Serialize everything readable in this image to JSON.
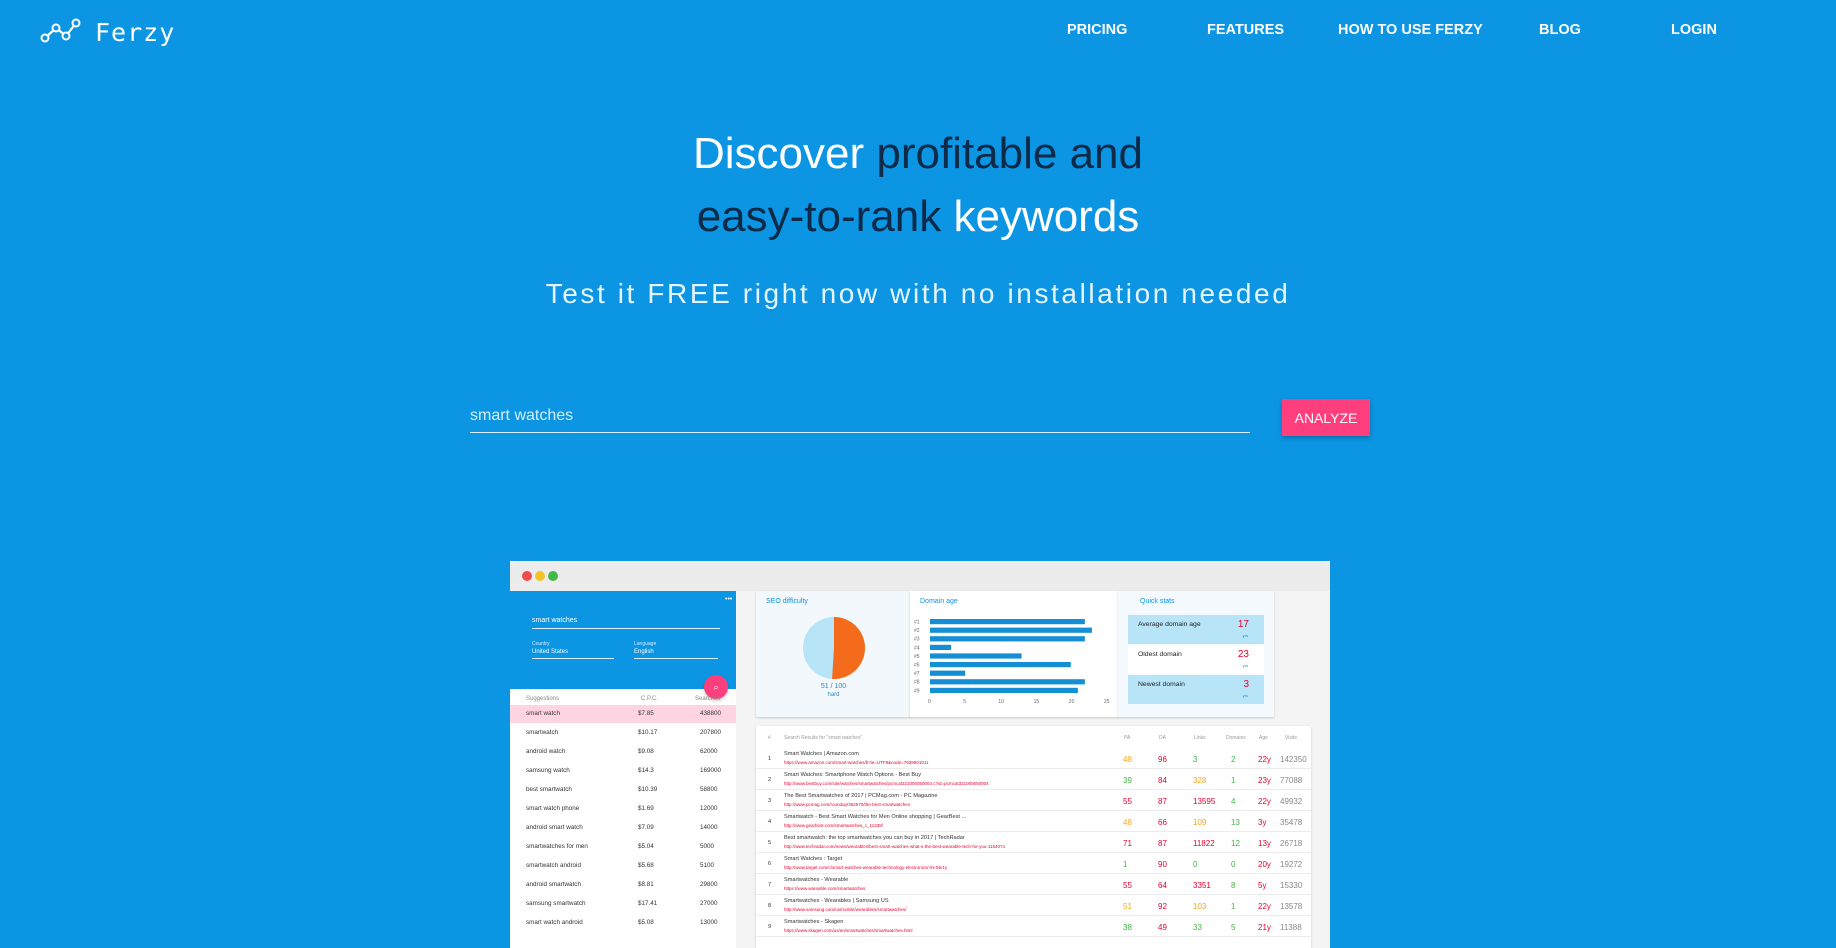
{
  "nav": {
    "brand": "Ferzy",
    "links": [
      "PRICING",
      "FEATURES",
      "HOW TO USE FERZY",
      "BLOG",
      "LOGIN"
    ]
  },
  "hero": {
    "line1_a": "Discover",
    "line1_b": "profitable and",
    "line2_a": "easy-to-rank",
    "line2_b": "keywords",
    "subtitle": "Test it FREE right now with no installation needed"
  },
  "search": {
    "placeholder": "smart watches",
    "button": "ANALYZE"
  },
  "preview": {
    "left_panel": {
      "query": "smart watches",
      "country_label": "Country",
      "country": "United States",
      "language_label": "Language",
      "language": "English",
      "headers": [
        "Suggestions",
        "C.P.C.",
        "Searches"
      ],
      "rows": [
        [
          "smart watch",
          "$7.85",
          "438800"
        ],
        [
          "smartwatch",
          "$10.17",
          "207800"
        ],
        [
          "android watch",
          "$9.08",
          "62000"
        ],
        [
          "samsung watch",
          "$14.3",
          "169000"
        ],
        [
          "best smartwatch",
          "$10.39",
          "58800"
        ],
        [
          "smart watch phone",
          "$1.69",
          "12000"
        ],
        [
          "android smart watch",
          "$7.09",
          "14000"
        ],
        [
          "smartwatches for men",
          "$5.04",
          "5000"
        ],
        [
          "smartwatch android",
          "$5.68",
          "5100"
        ],
        [
          "android smartwatch",
          "$8.81",
          "29800"
        ],
        [
          "samsung smartwatch",
          "$17.41",
          "27000"
        ],
        [
          "smart watch android",
          "$5.08",
          "13000"
        ]
      ]
    },
    "seo": {
      "title": "SEO difficulty",
      "score": "51 / 100",
      "rating": "hard",
      "value_fraction": 0.51
    },
    "domain_age": {
      "title": "Domain age",
      "labels": [
        "#1",
        "#2",
        "#3",
        "#4",
        "#5",
        "#6",
        "#7",
        "#8",
        "#9"
      ],
      "values": [
        22,
        23,
        22,
        3,
        13,
        20,
        5,
        22,
        21
      ],
      "ticks": [
        "0",
        "5",
        "10",
        "15",
        "20",
        "25"
      ]
    },
    "quick_stats": {
      "title": "Quick stats",
      "items": [
        {
          "label": "Average domain age",
          "value": "17",
          "unit": "yrs"
        },
        {
          "label": "Oldest domain",
          "value": "23",
          "unit": "yrs"
        },
        {
          "label": "Newest domain",
          "value": "3",
          "unit": "yrs"
        }
      ]
    },
    "results": {
      "headers": [
        "#",
        "Search Results for \"smart watches\"",
        "PA",
        "DA",
        "Links",
        "Domains",
        "Age",
        "Visits"
      ],
      "rows": [
        {
          "n": "1",
          "title": "Smart Watches | Amazon.com",
          "url": "https://www.amazon.com/smart-watches/b?ie=UTF8&node=7939901011",
          "pa": "48",
          "da": "96",
          "links": "3",
          "domains": "2",
          "age": "22y",
          "visits": "142350"
        },
        {
          "n": "2",
          "title": "Smart Watches: Smartphone Watch Options - Best Buy",
          "url": "http://www.bestbuy.com/site/watches/smartwatches/pcmcat321000050004.c?id=pcmcat321000050004",
          "pa": "39",
          "da": "84",
          "links": "328",
          "domains": "1",
          "age": "23y",
          "visits": "77088"
        },
        {
          "n": "3",
          "title": "The Best Smartwatches of 2017 | PCMag.com - PC Magazine",
          "url": "http://www.pcmag.com/roundup/352570/the-best-smartwatches",
          "pa": "55",
          "da": "87",
          "links": "13595",
          "domains": "4",
          "age": "22y",
          "visits": "49932"
        },
        {
          "n": "4",
          "title": "Smartwatch - Best Smart Watches for Men Online shopping | GearBest ...",
          "url": "http://www.gearbest.com/smartwatches_c_11338/",
          "pa": "48",
          "da": "66",
          "links": "109",
          "domains": "13",
          "age": "3y",
          "visits": "35478"
        },
        {
          "n": "5",
          "title": "Best smartwatch: the top smartwatches you can buy in 2017 | TechRadar",
          "url": "http://www.techradar.com/news/wearables/best-smart-watches-what-s-the-best-wearable-tech-for-you-1154074",
          "pa": "71",
          "da": "87",
          "links": "11822",
          "domains": "12",
          "age": "13y",
          "visits": "26718"
        },
        {
          "n": "6",
          "title": "Smart Watches : Target",
          "url": "http://www.target.com/c/smart-watches-wearable-technology-electronics/-/N-55r1y",
          "pa": "1",
          "da": "90",
          "links": "0",
          "domains": "0",
          "age": "20y",
          "visits": "19272"
        },
        {
          "n": "7",
          "title": "Smartwatches - Wearable",
          "url": "https://www.wareable.com/smartwatches",
          "pa": "55",
          "da": "64",
          "links": "3351",
          "domains": "8",
          "age": "5y",
          "visits": "15330"
        },
        {
          "n": "8",
          "title": "Smartwatches - Wearables | Samsung US",
          "url": "http://www.samsung.com/us/mobile/wearables/smartwatches/",
          "pa": "51",
          "da": "92",
          "links": "103",
          "domains": "1",
          "age": "22y",
          "visits": "13578"
        },
        {
          "n": "9",
          "title": "Smartwatches - Skagen",
          "url": "https://www.skagen.com/us/en/smartwatches/smartwatches.html",
          "pa": "38",
          "da": "49",
          "links": "33",
          "domains": "5",
          "age": "21y",
          "visits": "11388"
        }
      ]
    }
  }
}
